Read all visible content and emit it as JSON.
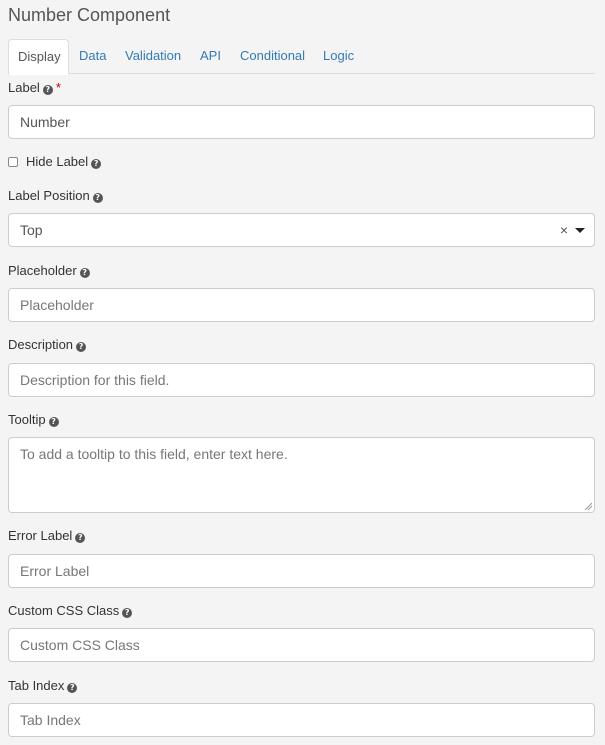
{
  "title": "Number Component",
  "tabs": [
    {
      "label": "Display",
      "active": true
    },
    {
      "label": "Data"
    },
    {
      "label": "Validation"
    },
    {
      "label": "API"
    },
    {
      "label": "Conditional"
    },
    {
      "label": "Logic"
    }
  ],
  "fields": {
    "label": {
      "label": "Label",
      "required_marker": "*",
      "value": "Number"
    },
    "hide_label": {
      "label": "Hide Label",
      "checked": false
    },
    "label_position": {
      "label": "Label Position",
      "value": "Top",
      "clear": "×"
    },
    "placeholder": {
      "label": "Placeholder",
      "placeholder": "Placeholder"
    },
    "description": {
      "label": "Description",
      "placeholder": "Description for this field."
    },
    "tooltip": {
      "label": "Tooltip",
      "placeholder": "To add a tooltip to this field, enter text here."
    },
    "error_label": {
      "label": "Error Label",
      "placeholder": "Error Label"
    },
    "custom_css": {
      "label": "Custom CSS Class",
      "placeholder": "Custom CSS Class"
    },
    "tab_index": {
      "label": "Tab Index",
      "placeholder": "Tab Index"
    }
  },
  "help_icon_glyph": "?",
  "colors": {
    "link": "#337ab7",
    "required": "#cc0000"
  }
}
